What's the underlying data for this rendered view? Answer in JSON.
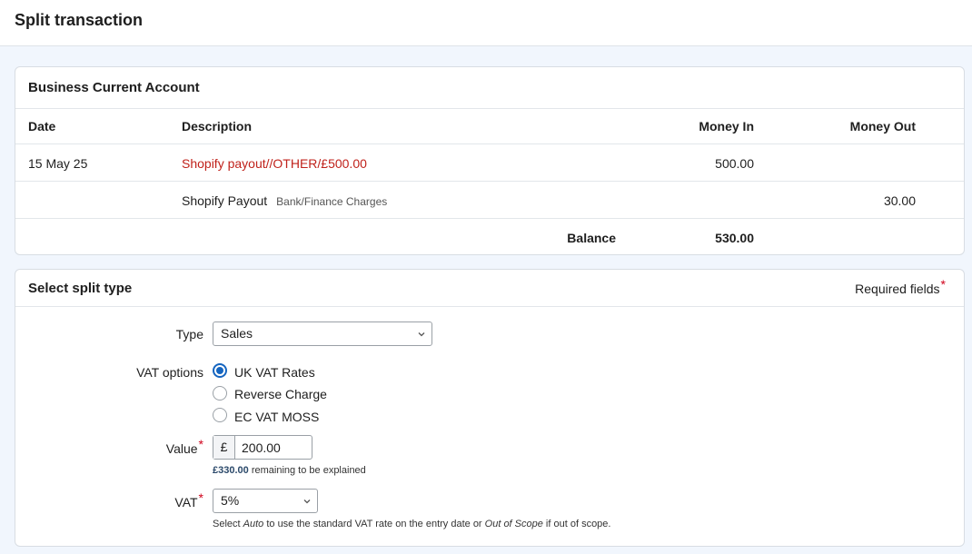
{
  "page": {
    "title": "Split transaction"
  },
  "account": {
    "title": "Business Current Account",
    "headers": {
      "date": "Date",
      "description": "Description",
      "money_in": "Money In",
      "money_out": "Money Out"
    },
    "rows": [
      {
        "date": "15 May 25",
        "description": "Shopify payout//OTHER/£500.00",
        "money_in": "500.00",
        "money_out": ""
      },
      {
        "date": "",
        "description": "Shopify Payout",
        "category": "Bank/Finance Charges",
        "money_in": "",
        "money_out": "30.00"
      }
    ],
    "balance_label": "Balance",
    "balance_value": "530.00"
  },
  "split": {
    "title": "Select split type",
    "required_label": "Required fields",
    "required_star": "*",
    "type_label": "Type",
    "type_value": "Sales",
    "vat_options_label": "VAT options",
    "vat_options": [
      {
        "label": "UK VAT Rates",
        "checked": true
      },
      {
        "label": "Reverse Charge",
        "checked": false
      },
      {
        "label": "EC VAT MOSS",
        "checked": false
      }
    ],
    "value_label": "Value",
    "value_prefix": "£",
    "value": "200.00",
    "remaining_amount": "£330.00",
    "remaining_text": " remaining to be explained",
    "vat_label": "VAT",
    "vat_value": "5%",
    "vat_hint_1": "Select ",
    "vat_hint_auto": "Auto",
    "vat_hint_2": " to use the standard VAT rate on the entry date or ",
    "vat_hint_oos": "Out of Scope",
    "vat_hint_3": " if out of scope."
  },
  "colors": {
    "accent": "#1565c0",
    "link_red": "#c0221b",
    "required": "#d0021b",
    "background": "#f1f6fd"
  },
  "icons": {
    "select_chevron": "chevron-down-icon"
  }
}
